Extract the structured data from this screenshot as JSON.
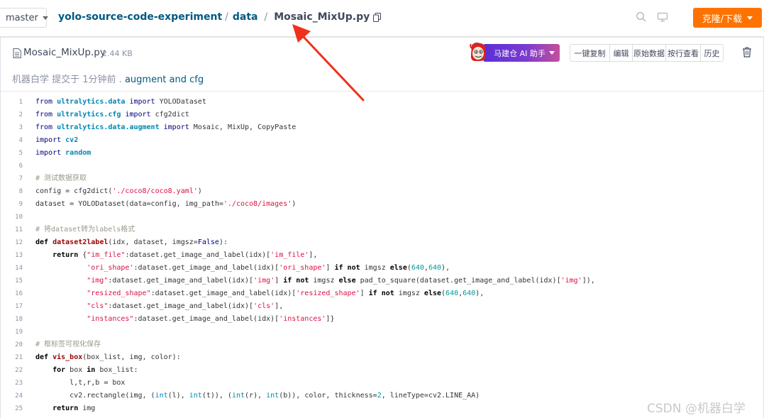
{
  "topbar": {
    "branch": "master",
    "breadcrumb": {
      "repo": "yolo-source-code-experiment",
      "sep1": "/",
      "folder": "data",
      "sep2": "/",
      "file": "Mosaic_MixUp.py"
    },
    "clone_label": "克隆/下载",
    "accent": "#fe7300"
  },
  "file": {
    "name": "Mosaic_MixUp.py",
    "size": "2.44 KB",
    "commit_author_time": "机器白学 提交于 1分钟前",
    "commit_sep": " . ",
    "commit_message": "augment and cfg",
    "ai_assistant_label": "马建仓 AI 助手",
    "actions": [
      "一键复制",
      "编辑",
      "原始数据",
      "按行查看",
      "历史"
    ]
  },
  "code": {
    "lines": [
      {
        "n": "1"
      },
      {
        "n": "2"
      },
      {
        "n": "3"
      },
      {
        "n": "4"
      },
      {
        "n": "5"
      },
      {
        "n": "6"
      },
      {
        "n": "7"
      },
      {
        "n": "8"
      },
      {
        "n": "9"
      },
      {
        "n": "10"
      },
      {
        "n": "11"
      },
      {
        "n": "12"
      },
      {
        "n": "13"
      },
      {
        "n": "14"
      },
      {
        "n": "15"
      },
      {
        "n": "16"
      },
      {
        "n": "17"
      },
      {
        "n": "18"
      },
      {
        "n": "19"
      },
      {
        "n": "20"
      },
      {
        "n": "21"
      },
      {
        "n": "22"
      },
      {
        "n": "23"
      },
      {
        "n": "24"
      },
      {
        "n": "25"
      }
    ],
    "tokens": [
      [
        [
          "kw2",
          "from "
        ],
        [
          "mod",
          "ultralytics.data"
        ],
        [
          "kw2",
          " import "
        ],
        [
          "",
          "YOLODataset"
        ]
      ],
      [
        [
          "kw2",
          "from "
        ],
        [
          "mod",
          "ultralytics.cfg"
        ],
        [
          "kw2",
          " import "
        ],
        [
          "",
          "cfg2dict"
        ]
      ],
      [
        [
          "kw2",
          "from "
        ],
        [
          "mod",
          "ultralytics.data.augment"
        ],
        [
          "kw2",
          " import "
        ],
        [
          "",
          "Mosaic, MixUp, CopyPaste"
        ]
      ],
      [
        [
          "kw2",
          "import "
        ],
        [
          "mod",
          "cv2"
        ]
      ],
      [
        [
          "kw2",
          "import "
        ],
        [
          "mod",
          "random"
        ]
      ],
      [],
      [
        [
          "cm",
          "# 测试数据获取"
        ]
      ],
      [
        [
          "",
          "config = cfg2dict("
        ],
        [
          "str",
          "'./coco8/coco8.yaml'"
        ],
        [
          "",
          ")"
        ]
      ],
      [
        [
          "",
          "dataset = YOLODataset(data=config, img_path="
        ],
        [
          "str",
          "'./coco8/images'"
        ],
        [
          "",
          ")"
        ]
      ],
      [],
      [
        [
          "cm",
          "# 将dataset转为labels格式"
        ]
      ],
      [
        [
          "kw",
          "def "
        ],
        [
          "fn",
          "dataset2label"
        ],
        [
          "",
          "(idx, dataset, imgsz="
        ],
        [
          "kw2",
          "False"
        ],
        [
          "",
          "):"
        ]
      ],
      [
        [
          "",
          "    "
        ],
        [
          "kw",
          "return"
        ],
        [
          "",
          " {"
        ],
        [
          "str",
          "\"im_file\""
        ],
        [
          "",
          ":dataset.get_image_and_label(idx)["
        ],
        [
          "str",
          "'im_file'"
        ],
        [
          "",
          "],"
        ]
      ],
      [
        [
          "",
          "            "
        ],
        [
          "str",
          "'ori_shape'"
        ],
        [
          "",
          ":dataset.get_image_and_label(idx)["
        ],
        [
          "str",
          "'ori_shape'"
        ],
        [
          "",
          "] "
        ],
        [
          "kw",
          "if"
        ],
        [
          "",
          " "
        ],
        [
          "kw",
          "not"
        ],
        [
          "",
          " imgsz "
        ],
        [
          "kw",
          "else"
        ],
        [
          "",
          "("
        ],
        [
          "num",
          "640"
        ],
        [
          "",
          ","
        ],
        [
          "num",
          "640"
        ],
        [
          "",
          "),"
        ]
      ],
      [
        [
          "",
          "            "
        ],
        [
          "str",
          "\"img\""
        ],
        [
          "",
          ":dataset.get_image_and_label(idx)["
        ],
        [
          "str",
          "'img'"
        ],
        [
          "",
          "] "
        ],
        [
          "kw",
          "if"
        ],
        [
          "",
          " "
        ],
        [
          "kw",
          "not"
        ],
        [
          "",
          " imgsz "
        ],
        [
          "kw",
          "else"
        ],
        [
          "",
          " pad_to_square(dataset.get_image_and_label(idx)["
        ],
        [
          "str",
          "'img'"
        ],
        [
          "",
          "]),"
        ]
      ],
      [
        [
          "",
          "            "
        ],
        [
          "str",
          "\"resized_shape\""
        ],
        [
          "",
          ":dataset.get_image_and_label(idx)["
        ],
        [
          "str",
          "'resized_shape'"
        ],
        [
          "",
          "] "
        ],
        [
          "kw",
          "if"
        ],
        [
          "",
          " "
        ],
        [
          "kw",
          "not"
        ],
        [
          "",
          " imgsz "
        ],
        [
          "kw",
          "else"
        ],
        [
          "",
          "("
        ],
        [
          "num",
          "640"
        ],
        [
          "",
          ","
        ],
        [
          "num",
          "640"
        ],
        [
          "",
          "),"
        ]
      ],
      [
        [
          "",
          "            "
        ],
        [
          "str",
          "\"cls\""
        ],
        [
          "",
          ":dataset.get_image_and_label(idx)["
        ],
        [
          "str",
          "'cls'"
        ],
        [
          "",
          "],"
        ]
      ],
      [
        [
          "",
          "            "
        ],
        [
          "str",
          "\"instances\""
        ],
        [
          "",
          ":dataset.get_image_and_label(idx)["
        ],
        [
          "str",
          "'instances'"
        ],
        [
          "",
          "]}"
        ]
      ],
      [],
      [
        [
          "cm",
          "# 框标签可视化保存"
        ]
      ],
      [
        [
          "kw",
          "def "
        ],
        [
          "fn",
          "vis_box"
        ],
        [
          "",
          "(box_list, img, color):"
        ]
      ],
      [
        [
          "",
          "    "
        ],
        [
          "kw",
          "for"
        ],
        [
          "",
          " box "
        ],
        [
          "kw",
          "in"
        ],
        [
          "",
          " box_list:"
        ]
      ],
      [
        [
          "",
          "        l,t,r,b = box"
        ]
      ],
      [
        [
          "",
          "        cv2.rectangle(img, ("
        ],
        [
          "bi",
          "int"
        ],
        [
          "",
          "(l), "
        ],
        [
          "bi",
          "int"
        ],
        [
          "",
          "(t)), ("
        ],
        [
          "bi",
          "int"
        ],
        [
          "",
          "(r), "
        ],
        [
          "bi",
          "int"
        ],
        [
          "",
          "(b)), color, thickness="
        ],
        [
          "num",
          "2"
        ],
        [
          "",
          ", lineType=cv2.LINE_AA)"
        ]
      ],
      [
        [
          "",
          "    "
        ],
        [
          "kw",
          "return"
        ],
        [
          "",
          " img"
        ]
      ]
    ]
  },
  "watermark": "CSDN @机器白学"
}
